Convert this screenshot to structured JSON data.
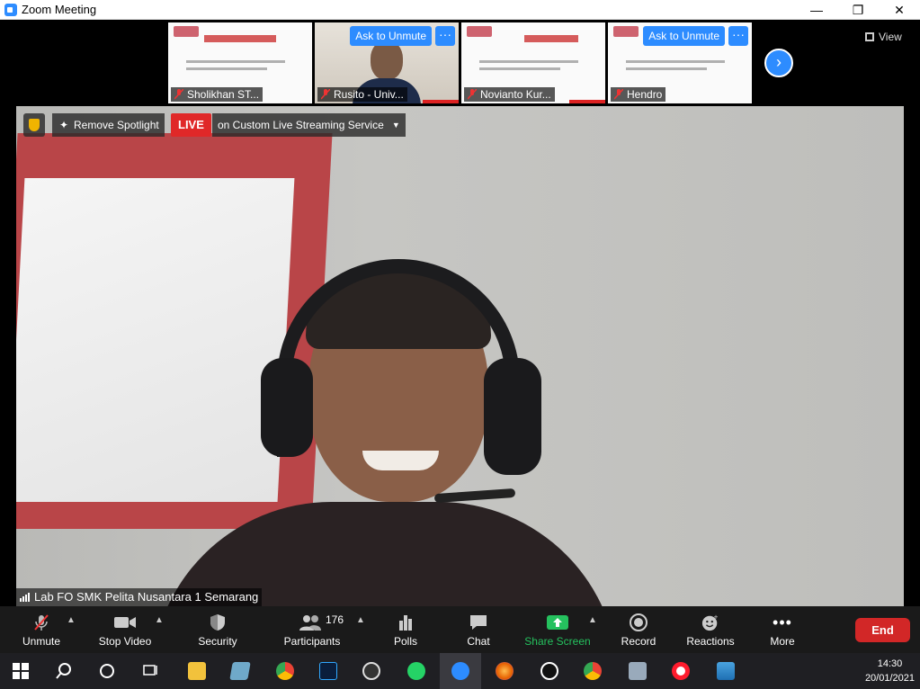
{
  "window": {
    "title": "Zoom Meeting"
  },
  "thumbnails": [
    {
      "name": "Sholikhan ST...",
      "ask_unmute": "",
      "more": ""
    },
    {
      "name": "Rusito - Univ...",
      "ask_unmute": "Ask to Unmute",
      "more": "···"
    },
    {
      "name": "Novianto Kur...",
      "ask_unmute": "",
      "more": ""
    },
    {
      "name": "Hendro",
      "ask_unmute": "Ask to Unmute",
      "more": "···"
    }
  ],
  "view_label": "View",
  "spotlight": {
    "remove_label": "Remove Spotlight",
    "live_label": "LIVE",
    "live_service": "on Custom Live Streaming Service"
  },
  "speaker_name": "Lab FO SMK Pelita Nusantara 1 Semarang",
  "toolbar": {
    "unmute": "Unmute",
    "stop_video": "Stop Video",
    "security": "Security",
    "participants": "Participants",
    "participants_count": "176",
    "polls": "Polls",
    "chat": "Chat",
    "share_screen": "Share Screen",
    "record": "Record",
    "reactions": "Reactions",
    "more": "More",
    "end": "End"
  },
  "taskbar": {
    "time": "14:30",
    "date": "20/01/2021"
  },
  "colors": {
    "zoom_blue": "#2d8cff",
    "live_red": "#e02828",
    "end_red": "#d22727",
    "share_green": "#25c15e"
  }
}
